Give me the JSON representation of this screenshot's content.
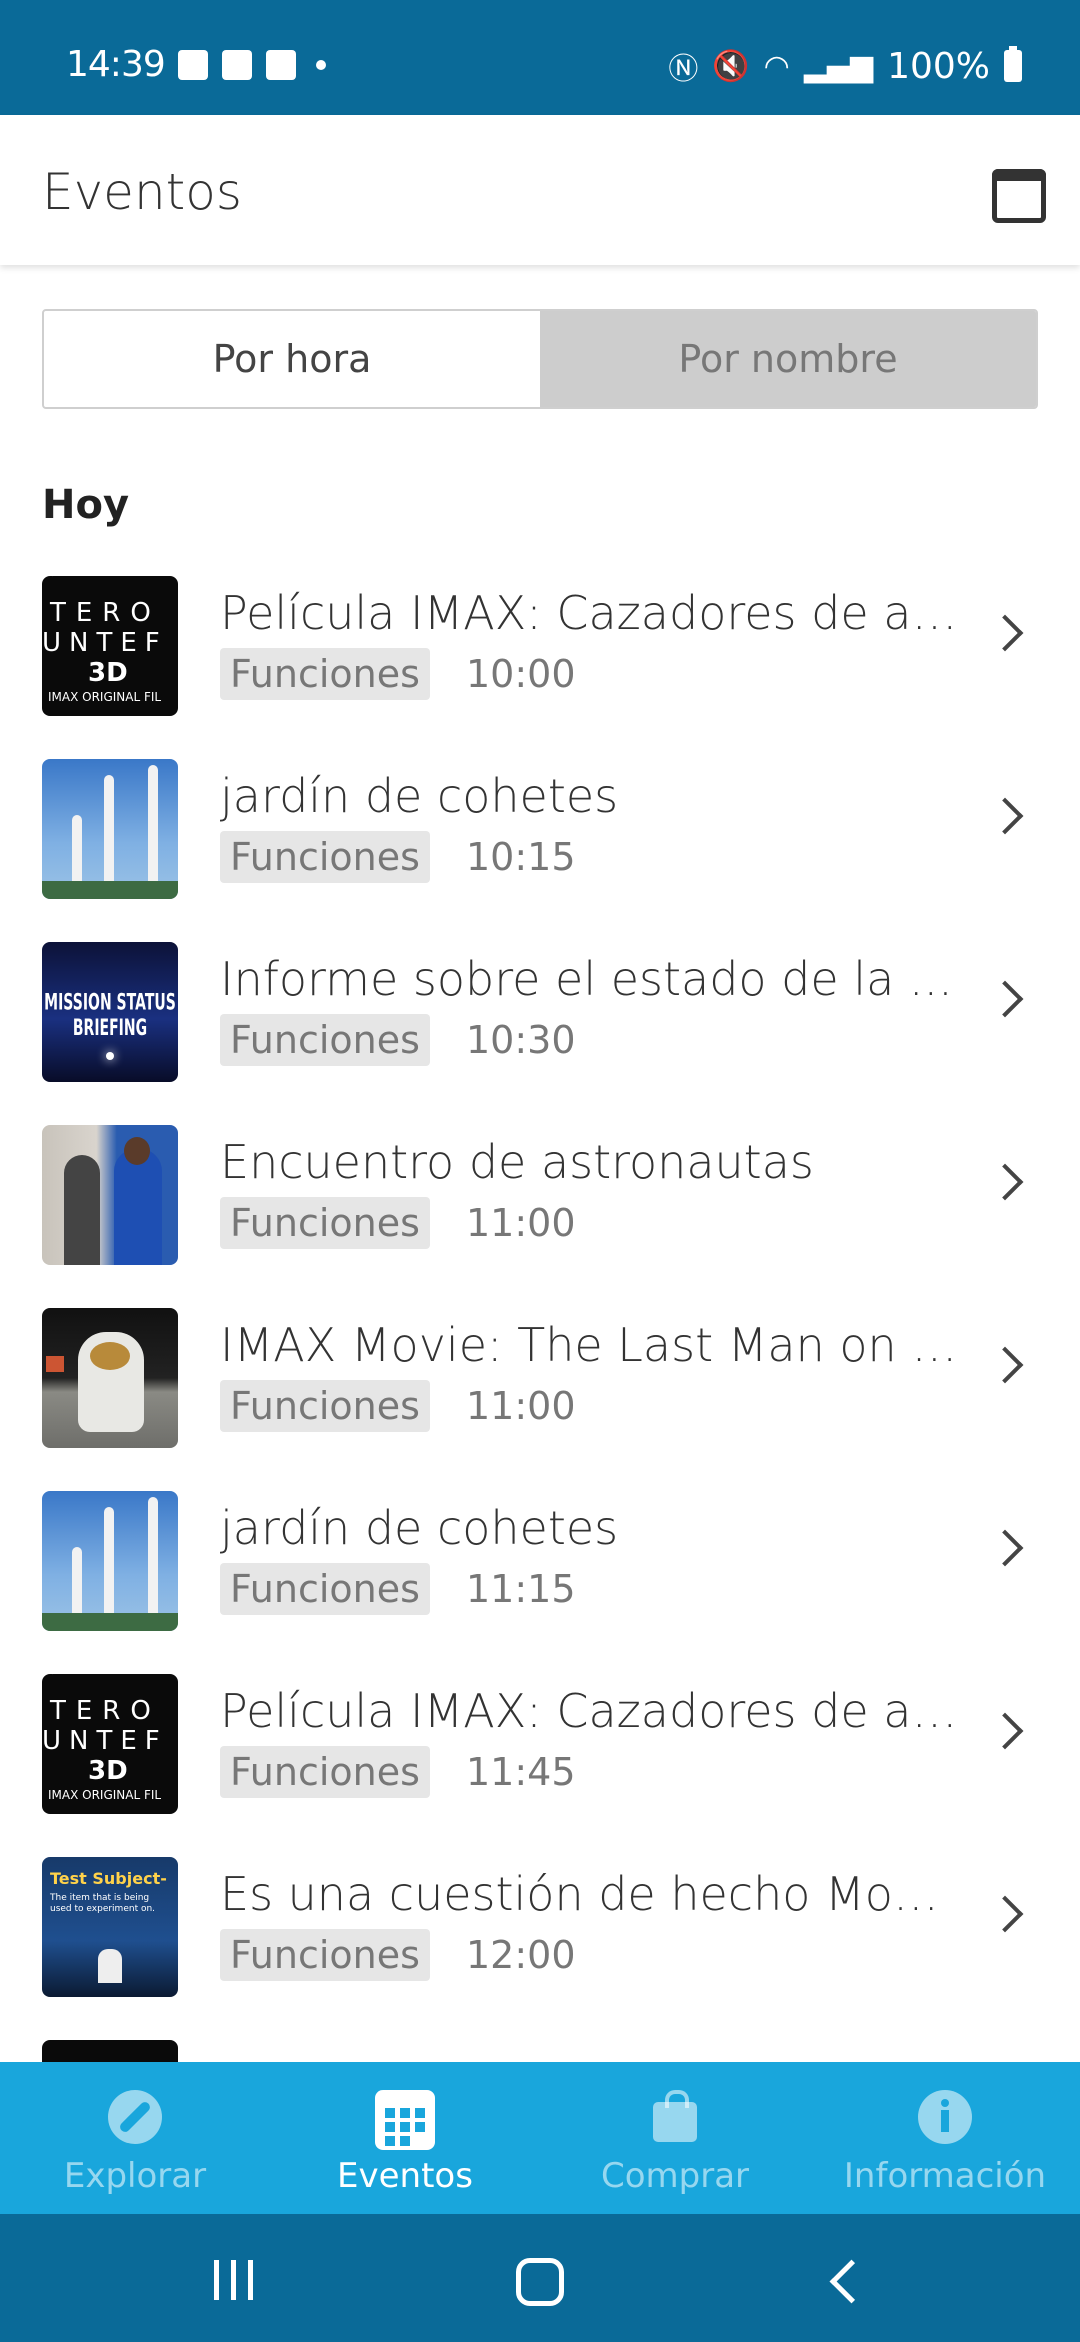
{
  "status_bar": {
    "time": "14:39",
    "battery": "100%",
    "notification_icons": [
      "image-icon",
      "calendar-29-icon",
      "check-icon",
      "dot-icon"
    ],
    "system_icons": [
      "nfc-icon",
      "mute-icon",
      "wifi-icon",
      "signal-icon",
      "battery-icon"
    ]
  },
  "header": {
    "title": "Eventos",
    "calendar_icon": "calendar-icon"
  },
  "segment": {
    "options": [
      "Por hora",
      "Por nombre"
    ],
    "selected": "Por hora"
  },
  "section_title": "Hoy",
  "events": [
    {
      "title": "Película IMAX: Cazadores de as...",
      "tag": "Funciones",
      "time": "10:00",
      "thumb": "imax"
    },
    {
      "title": "jardín de cohetes",
      "tag": "Funciones",
      "time": "10:15",
      "thumb": "rocket"
    },
    {
      "title": "Informe sobre el estado de la ...",
      "tag": "Funciones",
      "time": "10:30",
      "thumb": "mission"
    },
    {
      "title": "Encuentro de astronautas",
      "tag": "Funciones",
      "time": "11:00",
      "thumb": "astro"
    },
    {
      "title": "IMAX Movie: The Last Man on t...",
      "tag": "Funciones",
      "time": "11:00",
      "thumb": "moon"
    },
    {
      "title": "jardín de cohetes",
      "tag": "Funciones",
      "time": "11:15",
      "thumb": "rocket"
    },
    {
      "title": "Película IMAX: Cazadores de as...",
      "tag": "Funciones",
      "time": "11:45",
      "thumb": "imax"
    },
    {
      "title": "Es una cuestión de hecho Mos...",
      "tag": "Funciones",
      "time": "12:00",
      "thumb": "test"
    }
  ],
  "thumb_text": {
    "imax_line1": "TERO",
    "imax_line2": "UNTEF",
    "imax_line3": "3D",
    "imax_line4": "IMAX ORIGINAL FIL",
    "mission": "MISSION STATUS BRIEFING",
    "test_title": "Test Subject-",
    "test_sub": "The item that is being used to experiment on."
  },
  "bottom_nav": [
    {
      "label": "Explorar",
      "icon": "compass-icon",
      "active": false
    },
    {
      "label": "Eventos",
      "icon": "calendar-grid-icon",
      "active": true
    },
    {
      "label": "Comprar",
      "icon": "shopping-bag-icon",
      "active": false
    },
    {
      "label": "Información",
      "icon": "info-icon",
      "active": false
    }
  ],
  "colors": {
    "status_bar": "#0a6a98",
    "bottom_nav": "#19a6dc",
    "tag_bg": "#e6e6e6"
  }
}
